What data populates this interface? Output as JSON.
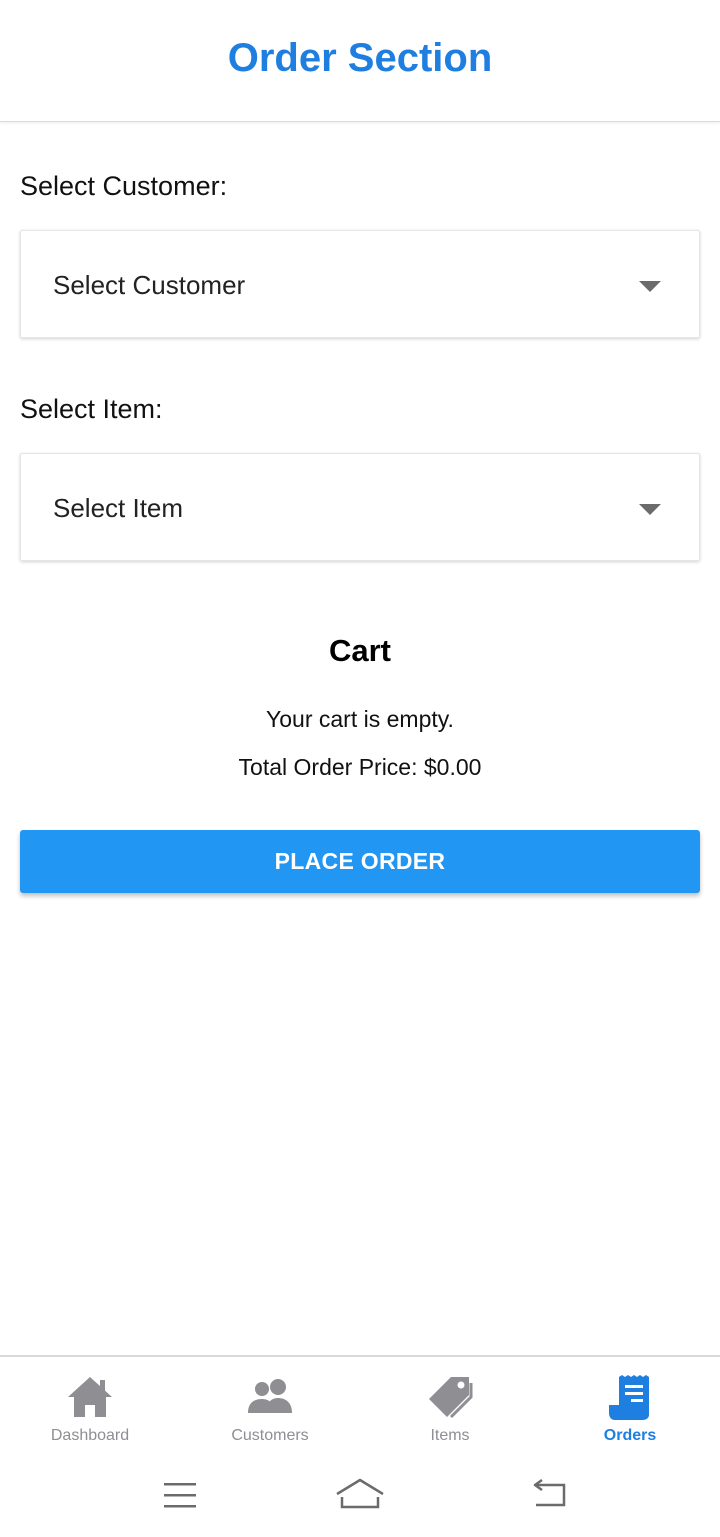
{
  "header": {
    "title": "Order Section"
  },
  "customer": {
    "label": "Select Customer:",
    "selected": "Select Customer"
  },
  "item": {
    "label": "Select Item:",
    "selected": "Select Item"
  },
  "cart": {
    "title": "Cart",
    "empty_message": "Your cart is empty.",
    "total_text": "Total Order Price: $0.00"
  },
  "actions": {
    "place_order_label": "PLACE ORDER"
  },
  "tabs": [
    {
      "label": "Dashboard",
      "icon": "home-icon",
      "active": false
    },
    {
      "label": "Customers",
      "icon": "people-icon",
      "active": false
    },
    {
      "label": "Items",
      "icon": "tag-icon",
      "active": false
    },
    {
      "label": "Orders",
      "icon": "receipt-icon",
      "active": true
    }
  ],
  "system_nav": {
    "buttons": [
      "menu-icon",
      "home-outline-icon",
      "back-icon"
    ]
  },
  "colors": {
    "accent": "#1e7fe0",
    "button": "#2196f3",
    "inactive_tab": "#8e8e93"
  }
}
